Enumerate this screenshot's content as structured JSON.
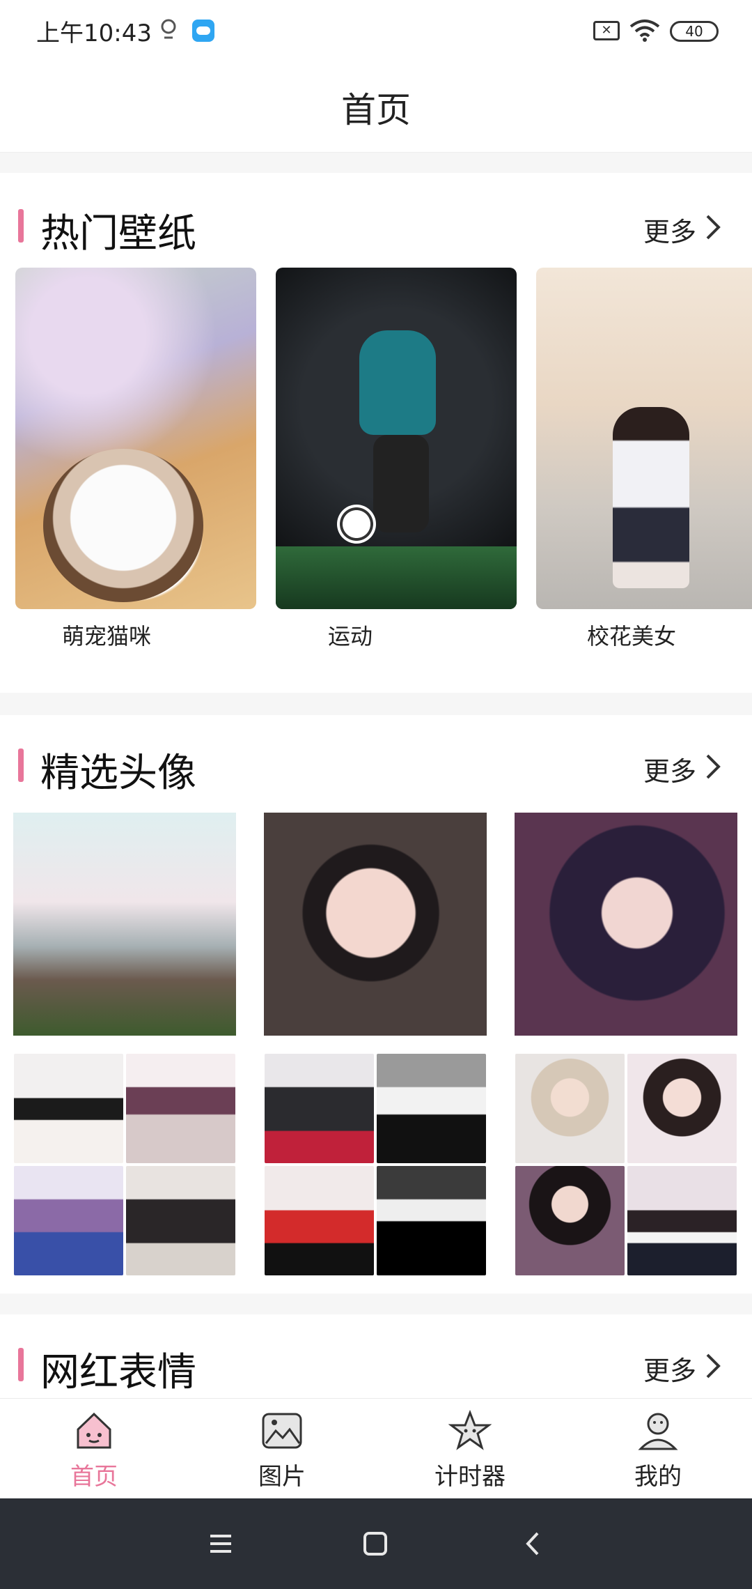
{
  "status_bar": {
    "time": "上午10:43",
    "battery": "40",
    "icons": [
      "location-pin-icon",
      "cloud-app-icon",
      "sim-blocked-icon",
      "wifi-icon",
      "battery-icon"
    ]
  },
  "header": {
    "title": "首页"
  },
  "sections": {
    "wallpapers": {
      "title": "热门壁纸",
      "more": "更多",
      "items": [
        {
          "label": "萌宠猫咪"
        },
        {
          "label": "运动"
        },
        {
          "label": "校花美女"
        }
      ]
    },
    "avatars": {
      "title": "精选头像",
      "more": "更多"
    },
    "emojis": {
      "title": "网红表情",
      "more": "更多"
    }
  },
  "bottom_nav": {
    "items": [
      {
        "label": "首页",
        "icon": "home-icon",
        "active": true
      },
      {
        "label": "图片",
        "icon": "image-icon",
        "active": false
      },
      {
        "label": "计时器",
        "icon": "star-timer-icon",
        "active": false
      },
      {
        "label": "我的",
        "icon": "profile-icon",
        "active": false
      }
    ]
  },
  "system_nav": {
    "icons": [
      "menu-icon",
      "home-square-icon",
      "back-icon"
    ]
  },
  "colors": {
    "accent": "#e8769a",
    "system_nav_bg": "#2b2f36"
  }
}
